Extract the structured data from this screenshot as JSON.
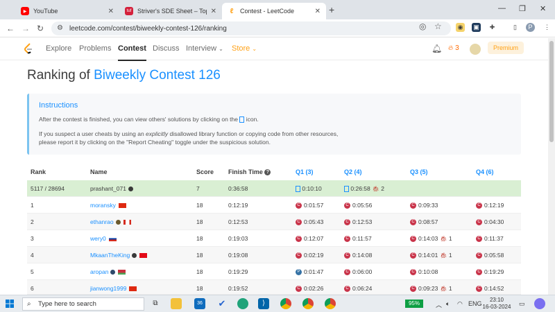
{
  "browser": {
    "tabs": [
      {
        "title": "YouTube",
        "active": false
      },
      {
        "title": "Striver's SDE Sheet – Top Codin",
        "active": false
      },
      {
        "title": "Contest - LeetCode",
        "active": true
      }
    ],
    "new_tab": "+",
    "url": "leetcode.com/contest/biweekly-contest-126/ranking",
    "profile_initial": "P"
  },
  "nav": {
    "links": [
      "Explore",
      "Problems",
      "Contest",
      "Discuss",
      "Interview",
      "Store"
    ],
    "active": "Contest",
    "streak": "3",
    "premium_label": "Premium"
  },
  "page": {
    "title_prefix": "Ranking of ",
    "title_link": "Biweekly Contest 126"
  },
  "instructions": {
    "title": "Instructions",
    "line1_before": "After the contest is finished, you can view others' solutions by clicking on the",
    "line1_after": "icon.",
    "line2_before": "If you suspect a user cheats by using an",
    "line2_em": "explicitly",
    "line2_after": "disallowed library function or copying code from other resources,",
    "line3": "please report it by clicking on the \"Report Cheating\" toggle under the suspicious solution."
  },
  "table": {
    "headers": {
      "rank": "Rank",
      "name": "Name",
      "score": "Score",
      "finish": "Finish Time",
      "q1": "Q1 (3)",
      "q2": "Q2 (4)",
      "q3": "Q3 (5)",
      "q4": "Q4 (6)"
    },
    "rows": [
      {
        "rank": "5117 / 28694",
        "name": "prashant_071",
        "score": "7",
        "finish": "0:36:58",
        "q1": "0:10:10",
        "q2": "0:26:58",
        "q2_bugs": "2",
        "q3": "",
        "q3_bugs": "",
        "q4": ""
      },
      {
        "rank": "1",
        "name": "moransky",
        "score": "18",
        "finish": "0:12:19",
        "q1": "0:01:57",
        "q2": "0:05:56",
        "q2_bugs": "",
        "q3": "0:09:33",
        "q3_bugs": "",
        "q4": "0:12:19"
      },
      {
        "rank": "2",
        "name": "ethanrao",
        "score": "18",
        "finish": "0:12:53",
        "q1": "0:05:43",
        "q2": "0:12:53",
        "q2_bugs": "",
        "q3": "0:08:57",
        "q3_bugs": "",
        "q4": "0:04:30"
      },
      {
        "rank": "3",
        "name": "wery0",
        "score": "18",
        "finish": "0:19:03",
        "q1": "0:12:07",
        "q2": "0:11:57",
        "q2_bugs": "",
        "q3": "0:14:03",
        "q3_bugs": "1",
        "q4": "0:11:37"
      },
      {
        "rank": "4",
        "name": "MkaanTheKing",
        "score": "18",
        "finish": "0:19:08",
        "q1": "0:02:19",
        "q2": "0:14:08",
        "q2_bugs": "",
        "q3": "0:14:01",
        "q3_bugs": "1",
        "q4": "0:05:58"
      },
      {
        "rank": "5",
        "name": "aropan",
        "score": "18",
        "finish": "0:19:29",
        "q1": "0:01:47",
        "q2": "0:06:00",
        "q2_bugs": "",
        "q3": "0:10:08",
        "q3_bugs": "",
        "q4": "0:19:29"
      },
      {
        "rank": "6",
        "name": "jianwong1999",
        "score": "18",
        "finish": "0:19:52",
        "q1": "0:02:26",
        "q2": "0:06:24",
        "q2_bugs": "",
        "q3": "0:09:23",
        "q3_bugs": "1",
        "q4": "0:14:52"
      }
    ]
  },
  "taskbar": {
    "search_placeholder": "Type here to search",
    "mail_badge": "36",
    "battery": "95%",
    "language": "ENG",
    "time": "23:10",
    "date": "16-03-2024"
  },
  "colors": {
    "accent_blue": "#1a90ff",
    "brand_orange": "#ffa116",
    "my_row_bg": "#d9efd3",
    "bug_red": "#c0392b"
  }
}
